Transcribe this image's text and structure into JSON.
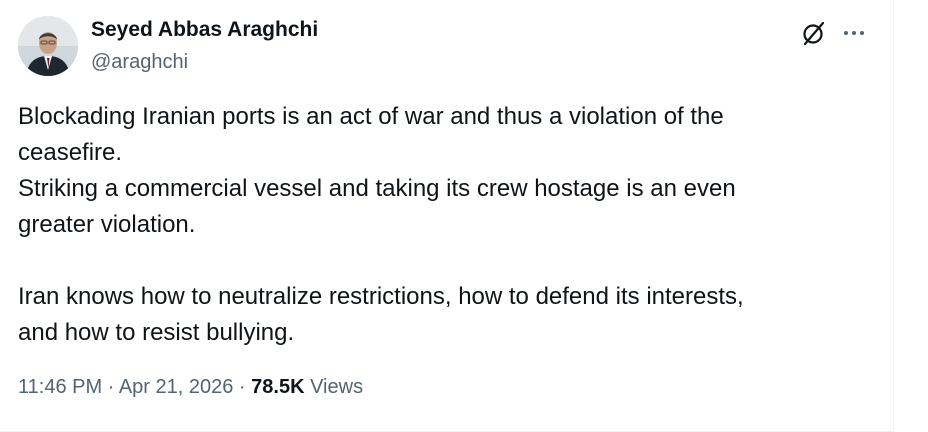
{
  "author": {
    "name": "Seyed Abbas Araghchi",
    "handle": "@araghchi"
  },
  "tweet": {
    "lines": [
      "Blockading Iranian ports is an act of war and thus a violation of the",
      "ceasefire.",
      "Striking a commercial vessel and taking its crew hostage is an even",
      "greater violation.",
      "Iran knows how to neutralize restrictions, how to defend its interests,",
      "and how to resist bullying."
    ]
  },
  "meta": {
    "time": "11:46 PM",
    "separator": "·",
    "date": "Apr 21, 2026",
    "views_count": "78.5K",
    "views_label": "Views"
  },
  "colors": {
    "text_primary": "#0f1419",
    "text_secondary": "#536471",
    "border": "#eff3f4"
  },
  "icons": {
    "grok": "grok-icon",
    "more": "more-icon"
  }
}
